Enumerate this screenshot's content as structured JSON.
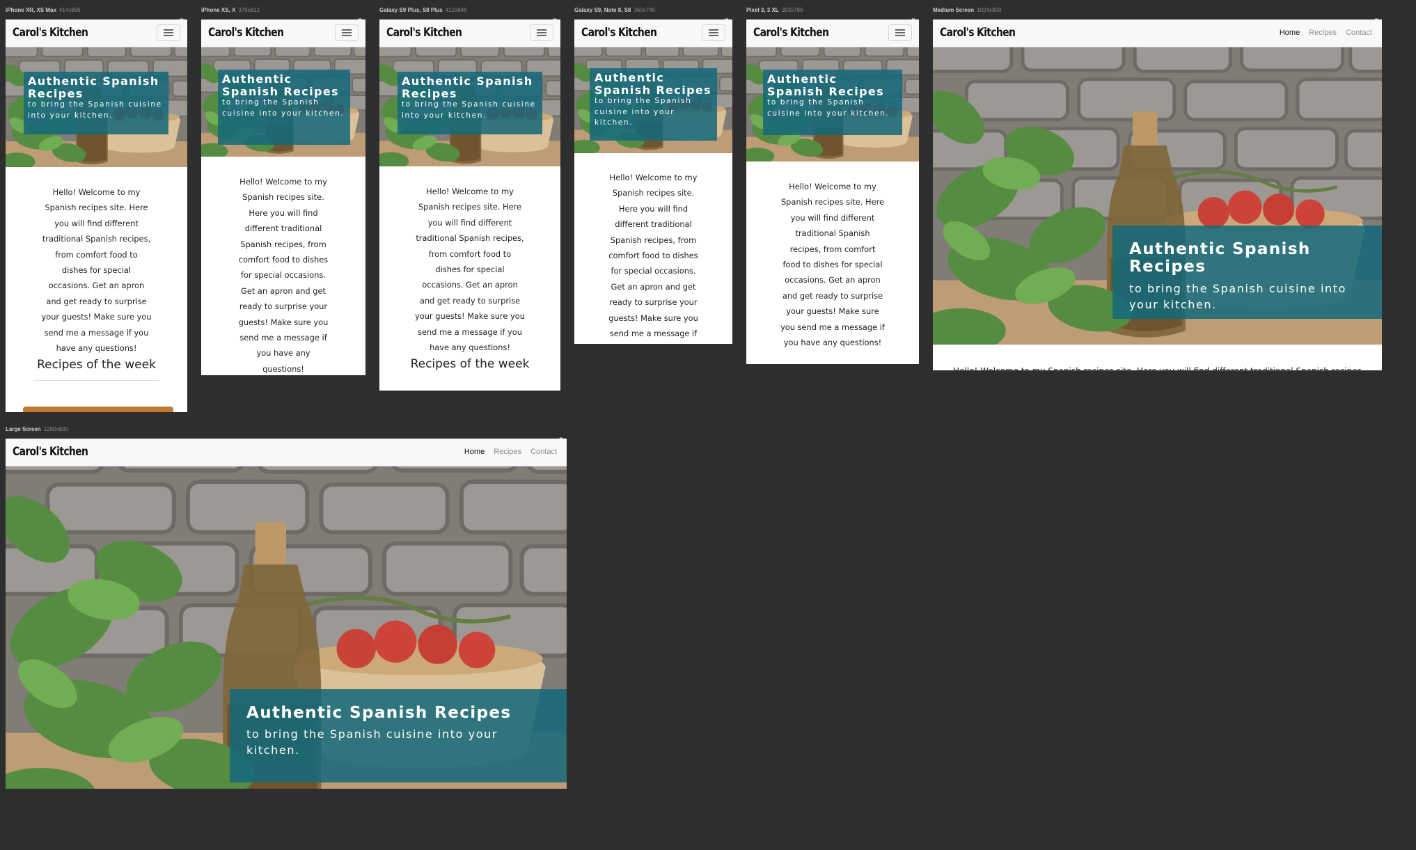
{
  "site": {
    "brand": "Carol's Kitchen",
    "hero_title": "Authentic Spanish Recipes",
    "hero_subtitle": "to bring the Spanish cuisine into your kitchen.",
    "welcome_text": "Hello! Welcome to my Spanish recipes site. Here you will find different traditional Spanish recipes, from comfort food to dishes for special occasions. Get an apron and get ready to surprise your guests! Make sure you send me a message if you have any questions!",
    "welcome_text_medium_cut": "Hello! Welcome to my Spanish recipes site. Here you will find different traditional Spanish recipes",
    "recipes_heading": "Recipes of the week",
    "nav": {
      "home": "Home",
      "recipes": "Recipes",
      "contact": "Contact"
    }
  },
  "devices": [
    {
      "name": "iPhone XR, XS Max",
      "size": "414x896"
    },
    {
      "name": "iPhone XS, X",
      "size": "375x812"
    },
    {
      "name": "Galaxy S9 Plus, S8 Plus",
      "size": "412x846"
    },
    {
      "name": "Galaxy S9, Note 8, S8",
      "size": "360x740"
    },
    {
      "name": "Pixel 3, 3 XL",
      "size": "393x786"
    },
    {
      "name": "Medium Screen",
      "size": "1024x800"
    },
    {
      "name": "Large Screen",
      "size": "1280x800"
    }
  ],
  "colors": {
    "background": "#2e2e2e",
    "caption": "#14697a",
    "nav": "#f8f8f8"
  },
  "icons": {
    "screenshot": "camera-icon",
    "menu": "hamburger-icon"
  }
}
